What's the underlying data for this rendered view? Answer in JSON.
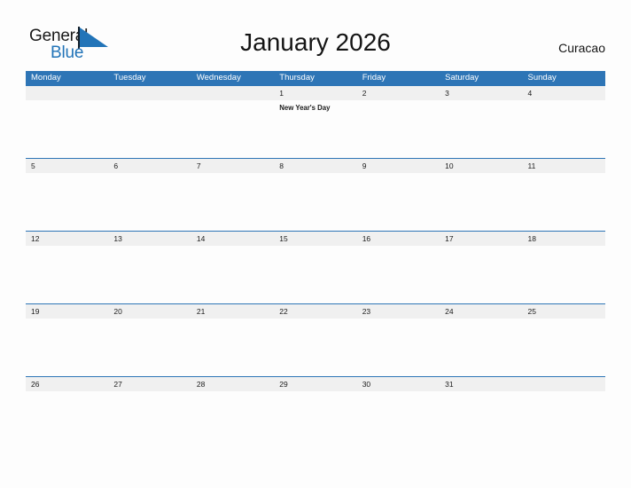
{
  "brand": {
    "name_part1": "General",
    "name_part2": "Blue",
    "flag_icon": "flag-triangle-icon",
    "accent_color": "#2274b8"
  },
  "header": {
    "title": "January 2026",
    "location": "Curacao"
  },
  "colors": {
    "header_blue": "#2e75b6",
    "row_gray": "#f0f0f0",
    "page_background": "#fdfdfd",
    "text": "#1b1b1b"
  },
  "calendar": {
    "month": "January",
    "year": "2026",
    "weekday_headers": [
      "Monday",
      "Tuesday",
      "Wednesday",
      "Thursday",
      "Friday",
      "Saturday",
      "Sunday"
    ],
    "weeks": [
      {
        "days": [
          {
            "date": "",
            "event": ""
          },
          {
            "date": "",
            "event": ""
          },
          {
            "date": "",
            "event": ""
          },
          {
            "date": "1",
            "event": "New Year's Day"
          },
          {
            "date": "2",
            "event": ""
          },
          {
            "date": "3",
            "event": ""
          },
          {
            "date": "4",
            "event": ""
          }
        ]
      },
      {
        "days": [
          {
            "date": "5",
            "event": ""
          },
          {
            "date": "6",
            "event": ""
          },
          {
            "date": "7",
            "event": ""
          },
          {
            "date": "8",
            "event": ""
          },
          {
            "date": "9",
            "event": ""
          },
          {
            "date": "10",
            "event": ""
          },
          {
            "date": "11",
            "event": ""
          }
        ]
      },
      {
        "days": [
          {
            "date": "12",
            "event": ""
          },
          {
            "date": "13",
            "event": ""
          },
          {
            "date": "14",
            "event": ""
          },
          {
            "date": "15",
            "event": ""
          },
          {
            "date": "16",
            "event": ""
          },
          {
            "date": "17",
            "event": ""
          },
          {
            "date": "18",
            "event": ""
          }
        ]
      },
      {
        "days": [
          {
            "date": "19",
            "event": ""
          },
          {
            "date": "20",
            "event": ""
          },
          {
            "date": "21",
            "event": ""
          },
          {
            "date": "22",
            "event": ""
          },
          {
            "date": "23",
            "event": ""
          },
          {
            "date": "24",
            "event": ""
          },
          {
            "date": "25",
            "event": ""
          }
        ]
      },
      {
        "days": [
          {
            "date": "26",
            "event": ""
          },
          {
            "date": "27",
            "event": ""
          },
          {
            "date": "28",
            "event": ""
          },
          {
            "date": "29",
            "event": ""
          },
          {
            "date": "30",
            "event": ""
          },
          {
            "date": "31",
            "event": ""
          },
          {
            "date": "",
            "event": ""
          }
        ]
      }
    ]
  }
}
